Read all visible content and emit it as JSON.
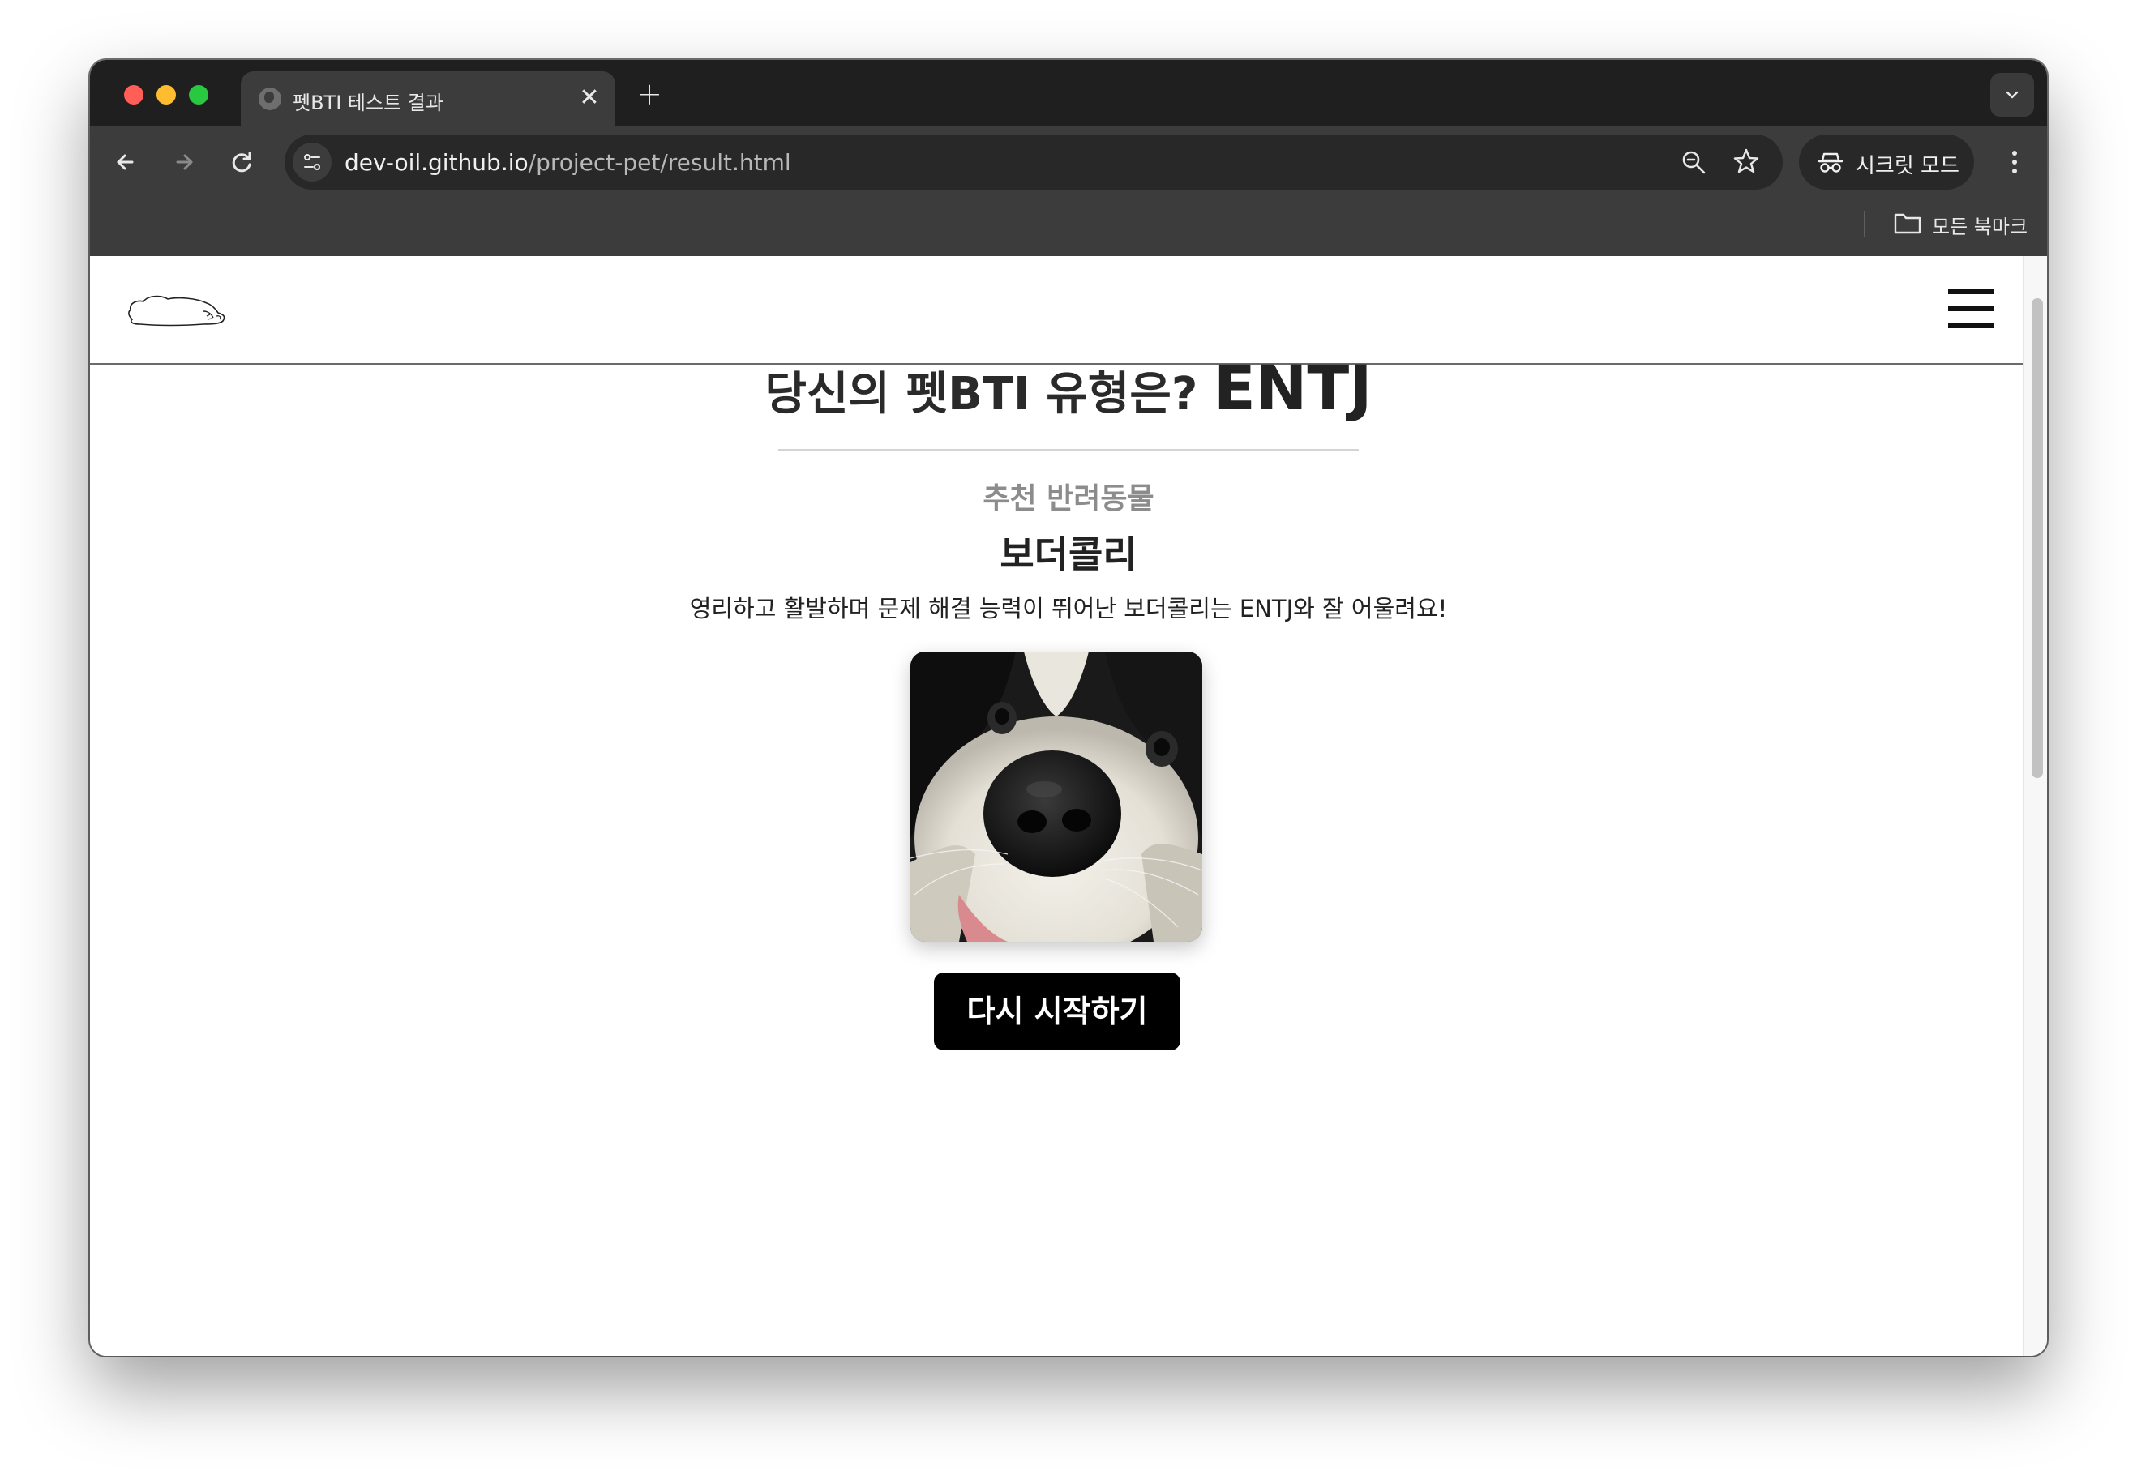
{
  "browser": {
    "tab": {
      "title": "펫BTI 테스트 결과",
      "close_glyph": "✕"
    },
    "new_tab_glyph": "+",
    "url": {
      "host": "dev-oil.github.io",
      "path": "/project-pet/result.html"
    },
    "incognito_label": "시크릿 모드",
    "bookmarks": {
      "all_bookmarks_label": "모든 북마크"
    }
  },
  "header": {
    "logo_icon": "sleeping-pet-outline-icon",
    "menu_icon": "hamburger-menu-icon"
  },
  "result": {
    "question": "당신의 펫BTI 유형은?",
    "type": "ENTJ",
    "recommend_label": "추천 반려동물",
    "pet_name": "보더콜리",
    "description": "영리하고 활발하며 문제 해결 능력이 뛰어난 보더콜리는 ENTJ와 잘 어울려요!",
    "restart_label": "다시 시작하기"
  },
  "colors": {
    "chrome_dark": "#1f1f1f",
    "toolbar": "#3c3c3c",
    "button_bg": "#000000",
    "sub_label": "#8c8c8c"
  }
}
